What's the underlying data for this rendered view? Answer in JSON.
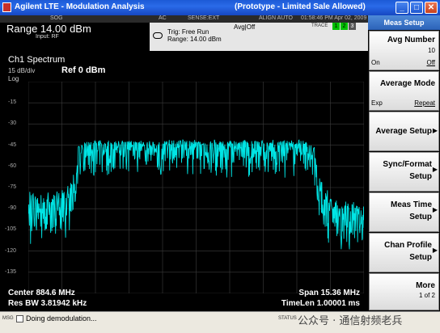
{
  "window": {
    "title": "Agilent LTE - Modulation Analysis",
    "center_title": "(Prototype - Limited Sale Allowed)"
  },
  "status": {
    "row1": [
      "SOG",
      "AC",
      "SENSE:EXT",
      "ALIGN AUTO",
      "01:58:46 PM Apr 02, 2009"
    ],
    "range": "Range  14.00 dBm",
    "input": "Input: RF",
    "trig": "Trig: Free Run",
    "range_short": "Range: 14.00 dBm",
    "avg": "Avg|Off",
    "trace_label": "TRACE",
    "trace_boxes": [
      "1",
      "2",
      "3"
    ]
  },
  "spectrum": {
    "title": "Ch1 Spectrum",
    "scale": "15 dB/div",
    "ref": "Ref 0 dBm",
    "log": "Log",
    "y_ticks": [
      "-15",
      "-30",
      "-45",
      "-60",
      "-75",
      "-90",
      "-105",
      "-120",
      "-135"
    ],
    "center": "Center 884.6 MHz",
    "res_bw": "Res BW 3.81942 kHz",
    "span": "Span 15.36 MHz",
    "time_len": "TimeLen 1.00001 ms"
  },
  "softkeys": {
    "menu_title": "Meas Setup",
    "avg_number": {
      "label": "Avg Number",
      "value": "10",
      "left": "On",
      "right": "Off"
    },
    "average_mode": {
      "label": "Average Mode",
      "left": "Exp",
      "right": "Repeat"
    },
    "average_setup": {
      "label": "Average Setup"
    },
    "sync_format": {
      "label1": "Sync/Format",
      "label2": "Setup"
    },
    "meas_time": {
      "label1": "Meas Time",
      "label2": "Setup"
    },
    "chan_profile": {
      "label1": "Chan Profile",
      "label2": "Setup"
    },
    "more": {
      "label": "More",
      "page": "1 of 2"
    }
  },
  "statusline": {
    "msg": "MSG",
    "text": "Doing demodulation...",
    "status": "STATUS",
    "watermark": "公众号 · 通信射频老兵"
  },
  "colors": {
    "trace": "#00e5e5",
    "plot_bg": "#000000",
    "grid": "#3c3c3c"
  },
  "chart_data": {
    "type": "line",
    "xlabel": "",
    "ylabel": "",
    "y_range_db": [
      -135,
      0
    ],
    "center_mhz": 884.6,
    "span_mhz": 15.36,
    "series": [
      {
        "x_mhz": [
          876.92,
          877.5,
          878.0,
          878.8,
          879.0,
          879.2,
          879.5,
          880.0,
          884.6,
          889.2,
          889.7,
          890.0,
          890.2,
          890.4,
          891.0,
          892.28
        ],
        "y_db": [
          -76,
          -77,
          -76,
          -72,
          -62,
          -43,
          -40,
          -40,
          -40,
          -40,
          -40,
          -43,
          -62,
          -72,
          -80,
          -82
        ]
      }
    ]
  }
}
